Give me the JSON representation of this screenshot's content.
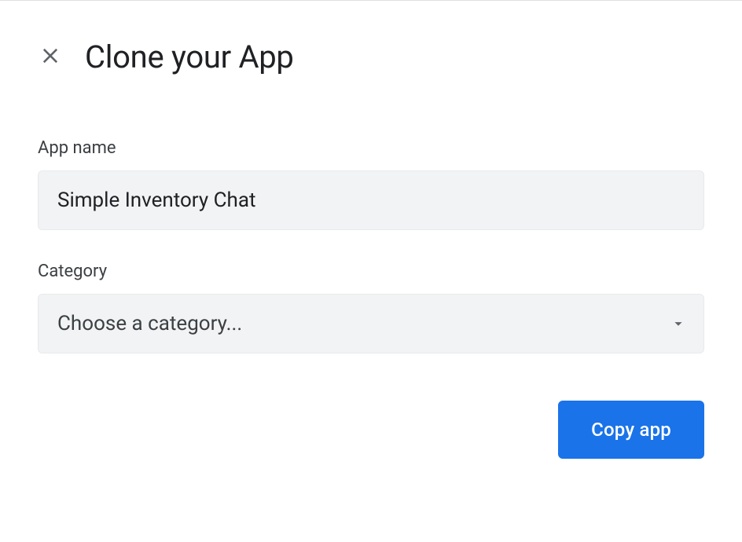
{
  "dialog": {
    "title": "Clone your App"
  },
  "fields": {
    "appName": {
      "label": "App name",
      "value": "Simple Inventory Chat"
    },
    "category": {
      "label": "Category",
      "placeholder": "Choose a category..."
    }
  },
  "actions": {
    "copy_label": "Copy app"
  }
}
